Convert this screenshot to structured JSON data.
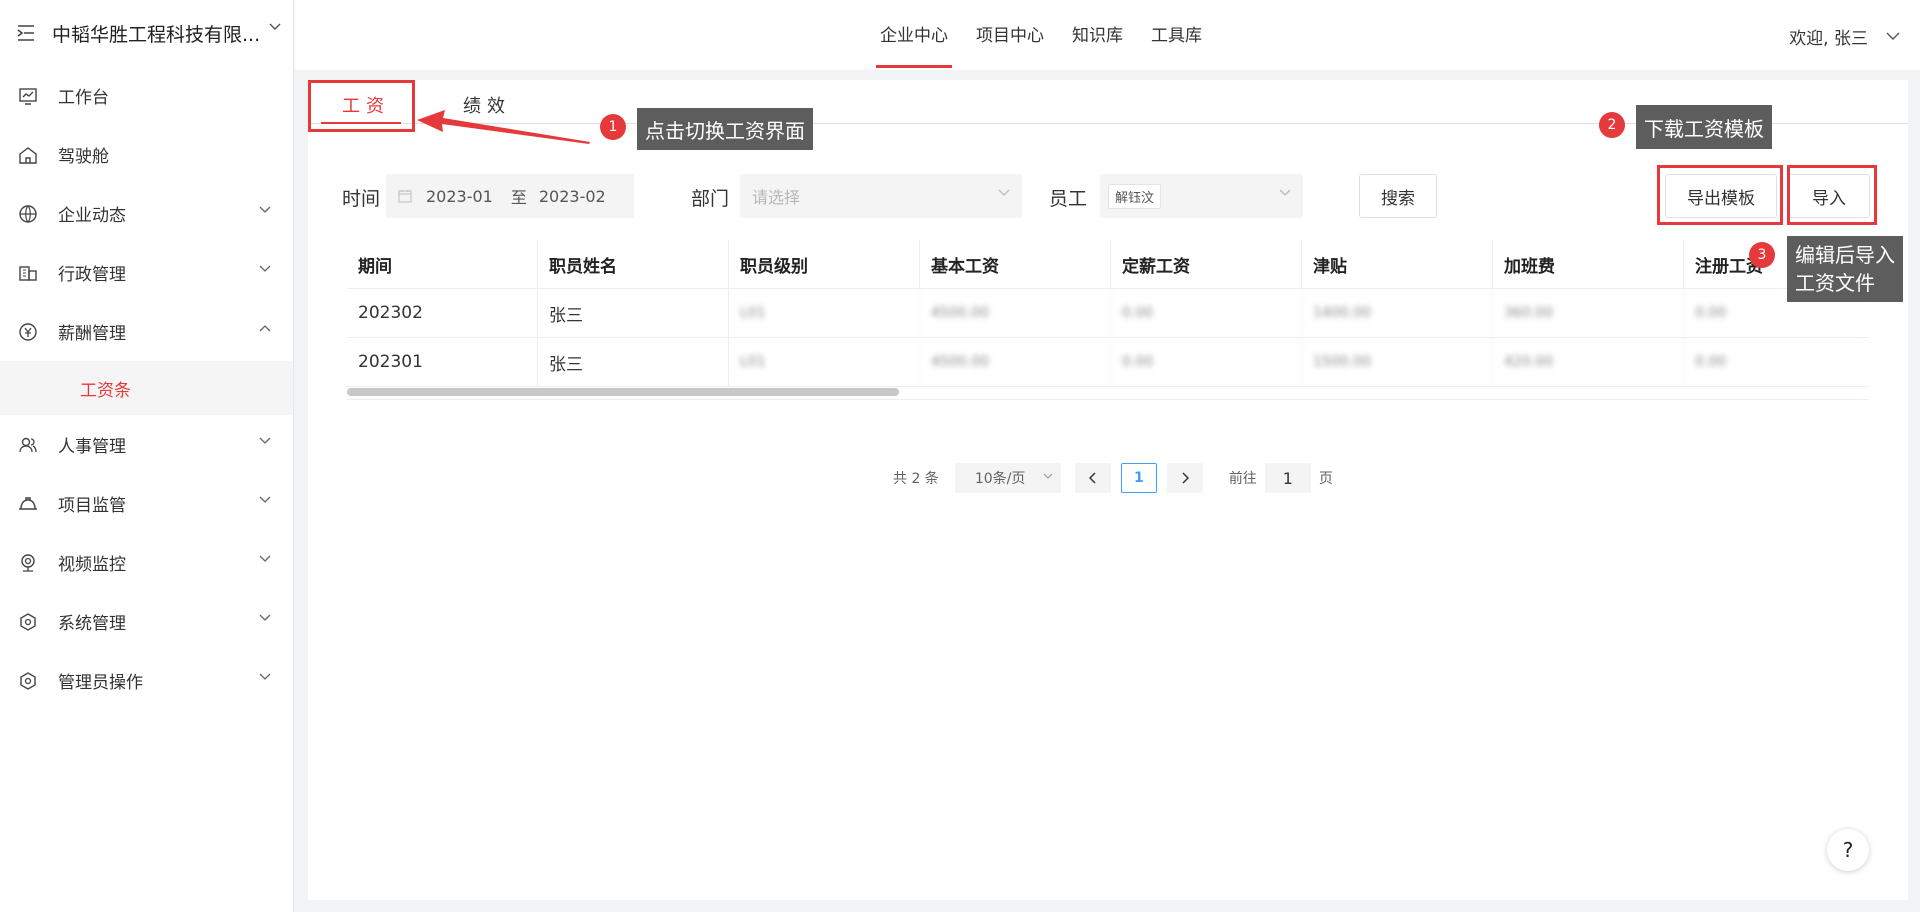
{
  "sidebar": {
    "company": "中韬华胜工程科技有限...",
    "items": [
      {
        "label": "工作台",
        "icon": "monitor-chart-icon",
        "expandable": false
      },
      {
        "label": "驾驶舱",
        "icon": "home-icon",
        "expandable": false
      },
      {
        "label": "企业动态",
        "icon": "globe-icon",
        "expandable": true
      },
      {
        "label": "行政管理",
        "icon": "building-icon",
        "expandable": true
      },
      {
        "label": "薪酬管理",
        "icon": "money-icon",
        "expandable": true,
        "expanded": true
      },
      {
        "label": "人事管理",
        "icon": "people-icon",
        "expandable": true
      },
      {
        "label": "项目监管",
        "icon": "helmet-icon",
        "expandable": true
      },
      {
        "label": "视频监控",
        "icon": "camera-icon",
        "expandable": true
      },
      {
        "label": "系统管理",
        "icon": "settings-icon",
        "expandable": true
      },
      {
        "label": "管理员操作",
        "icon": "settings-icon",
        "expandable": true
      }
    ],
    "sub_item": "工资条"
  },
  "topnav": {
    "items": [
      "企业中心",
      "项目中心",
      "知识库",
      "工具库"
    ],
    "active": "企业中心",
    "welcome": "欢迎, 张三"
  },
  "tabs": {
    "salary": "工资",
    "performance": "绩效"
  },
  "filters": {
    "time_label": "时间",
    "date_start": "2023-01",
    "date_sep": "至",
    "date_end": "2023-02",
    "dept_label": "部门",
    "dept_placeholder": "请选择",
    "employee_label": "员工",
    "employee_tag": "解钰汶",
    "search_btn": "搜索",
    "export_btn": "导出模板",
    "import_btn": "导入"
  },
  "table": {
    "headers": [
      "期间",
      "职员姓名",
      "职员级别",
      "基本工资",
      "定薪工资",
      "津贴",
      "加班费",
      "注册工资"
    ],
    "rows": [
      [
        "202302",
        "张三",
        "L01",
        "4500.00",
        "0.00",
        "1400.00",
        "360.00",
        "0.00"
      ],
      [
        "202301",
        "张三",
        "L01",
        "4500.00",
        "0.00",
        "1500.00",
        "420.00",
        "0.00"
      ]
    ]
  },
  "pagination": {
    "total": "共 2 条",
    "page_size": "10条/页",
    "current": "1",
    "goto_prefix": "前往",
    "goto_value": "1",
    "goto_suffix": "页"
  },
  "help": "?",
  "annotations": {
    "n1": "1",
    "c1": "点击切换工资界面",
    "n2": "2",
    "c2": "下载工资模板",
    "n3": "3",
    "c3a": "编辑后导入",
    "c3b": "工资文件"
  },
  "colors": {
    "accent": "#e5393b",
    "callout": "#5d5d5d",
    "pager_active": "#409eff"
  }
}
